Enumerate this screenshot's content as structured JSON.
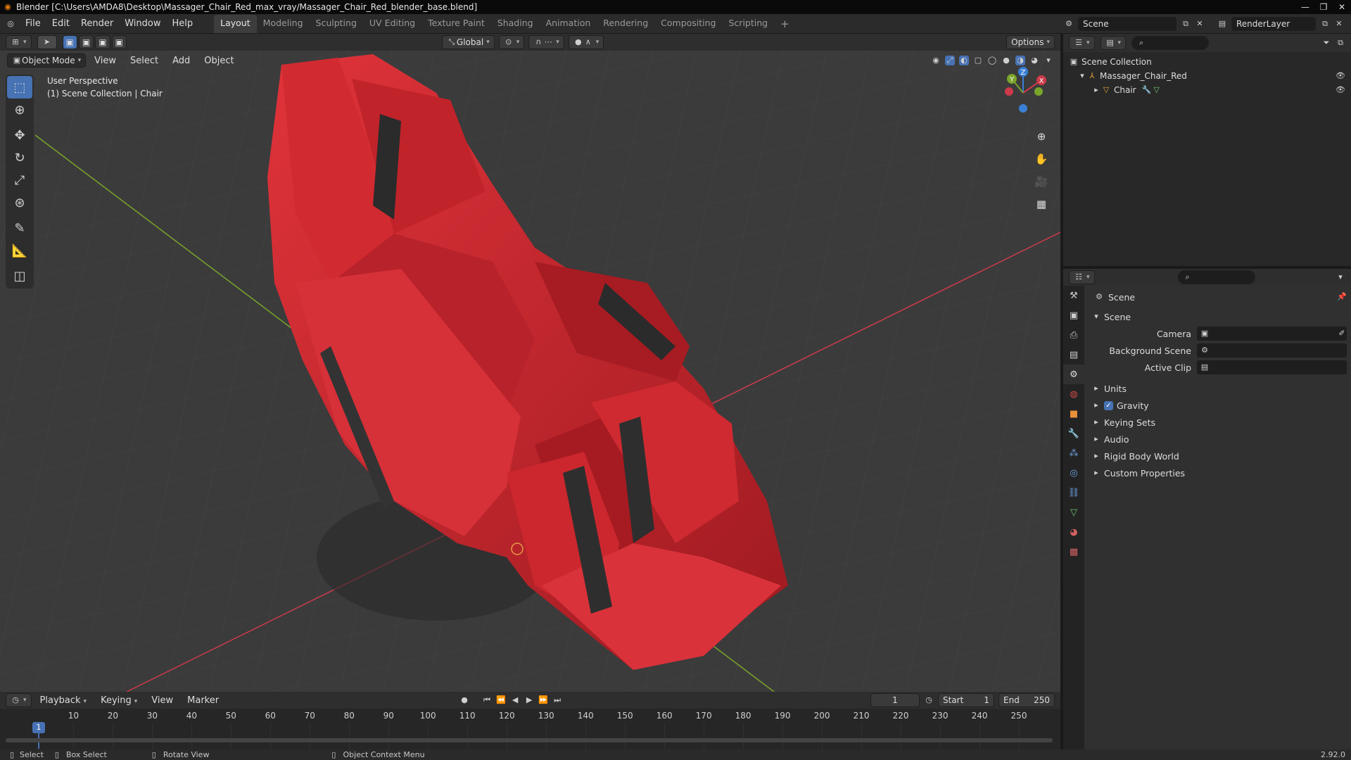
{
  "window": {
    "title": "Blender [C:\\Users\\AMDA8\\Desktop\\Massager_Chair_Red_max_vray/Massager_Chair_Red_blender_base.blend]"
  },
  "menus": [
    "File",
    "Edit",
    "Render",
    "Window",
    "Help"
  ],
  "workspaces": [
    {
      "label": "Layout",
      "active": true
    },
    {
      "label": "Modeling"
    },
    {
      "label": "Sculpting"
    },
    {
      "label": "UV Editing"
    },
    {
      "label": "Texture Paint"
    },
    {
      "label": "Shading"
    },
    {
      "label": "Animation"
    },
    {
      "label": "Rendering"
    },
    {
      "label": "Compositing"
    },
    {
      "label": "Scripting"
    },
    {
      "label": "+"
    }
  ],
  "scene_selector": {
    "value": "Scene"
  },
  "renderlayer_selector": {
    "value": "RenderLayer"
  },
  "header": {
    "orientation": "Global",
    "options": "Options"
  },
  "viewport_header": {
    "mode": "Object Mode",
    "menus": [
      "View",
      "Select",
      "Add",
      "Object"
    ]
  },
  "viewport": {
    "perspective": "User Perspective",
    "collection_info": "(1) Scene Collection | Chair",
    "gizmo_axes": {
      "z": "Z",
      "x": "X",
      "y": "Y"
    }
  },
  "outliner": {
    "root": "Scene Collection",
    "items": [
      {
        "label": "Massager_Chair_Red",
        "level": 1
      },
      {
        "label": "Chair",
        "level": 2
      }
    ]
  },
  "properties": {
    "context_title": "Scene",
    "panel_title": "Scene",
    "fields": [
      {
        "label": "Camera",
        "value": ""
      },
      {
        "label": "Background Scene",
        "value": ""
      },
      {
        "label": "Active Clip",
        "value": ""
      }
    ],
    "subpanels": [
      {
        "label": "Units"
      },
      {
        "label": "Gravity",
        "checked": true
      },
      {
        "label": "Keying Sets"
      },
      {
        "label": "Audio"
      },
      {
        "label": "Rigid Body World"
      },
      {
        "label": "Custom Properties"
      }
    ]
  },
  "timeline": {
    "menus": [
      "Playback",
      "Keying",
      "View",
      "Marker"
    ],
    "current_frame": "1",
    "start_label": "Start",
    "start": "1",
    "end_label": "End",
    "end": "250",
    "ticks": [
      "1",
      "10",
      "20",
      "30",
      "40",
      "50",
      "60",
      "70",
      "80",
      "90",
      "100",
      "110",
      "120",
      "130",
      "140",
      "150",
      "160",
      "170",
      "180",
      "190",
      "200",
      "210",
      "220",
      "230",
      "240",
      "250"
    ]
  },
  "statusbar": {
    "select": "Select",
    "box_select": "Box Select",
    "rotate_view": "Rotate View",
    "context_menu": "Object Context Menu",
    "version": "2.92.0"
  },
  "colors": {
    "accent": "#4772b3",
    "chair_red": "#c8242c",
    "axis_x": "#cc3a4a",
    "axis_y": "#7aa52a",
    "axis_z": "#3a7fd6"
  }
}
